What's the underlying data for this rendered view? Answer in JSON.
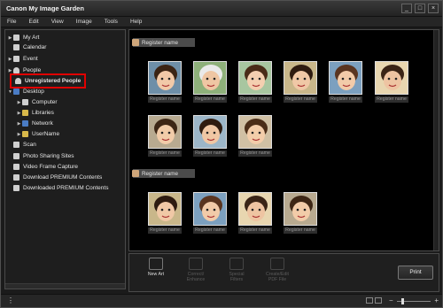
{
  "window": {
    "title": "Canon My Image Garden",
    "controls": [
      "_",
      "□",
      "×"
    ]
  },
  "menu": [
    "File",
    "Edit",
    "View",
    "Image",
    "Tools",
    "Help"
  ],
  "sidebar": {
    "items": [
      {
        "label": "My Art",
        "icon": "my-art-icon"
      },
      {
        "label": "Calendar",
        "icon": "calendar-icon"
      },
      {
        "label": "Event",
        "icon": "event-icon"
      },
      {
        "label": "People",
        "icon": "people-icon"
      },
      {
        "label": "Unregistered People",
        "icon": "unregistered-person-icon",
        "selected": true
      },
      {
        "label": "Desktop",
        "icon": "desktop-icon"
      },
      {
        "label": "Computer",
        "icon": "computer-icon"
      },
      {
        "label": "Libraries",
        "icon": "libraries-icon"
      },
      {
        "label": "Network",
        "icon": "network-icon"
      },
      {
        "label": "UserName",
        "icon": "user-folder-icon"
      },
      {
        "label": "Scan",
        "icon": "scan-icon"
      },
      {
        "label": "Photo Sharing Sites",
        "icon": "photo-sharing-icon"
      },
      {
        "label": "Video Frame Capture",
        "icon": "video-frame-icon"
      },
      {
        "label": "Download PREMIUM Contents",
        "icon": "download-icon"
      },
      {
        "label": "Downloaded PREMIUM Contents",
        "icon": "downloaded-icon"
      }
    ]
  },
  "groups": [
    {
      "title": "Register name",
      "photos": [
        "Register name",
        "Register name",
        "Register name",
        "Register name",
        "Register name",
        "Register name",
        "Register name",
        "Register name",
        "Register name"
      ]
    },
    {
      "title": "Register name",
      "photos": [
        "Register name",
        "Register name",
        "Register name",
        "Register name"
      ]
    }
  ],
  "toolbar": {
    "new_art": "New Art",
    "correct_enhance": "Correct/\nEnhance",
    "special_filters": "Special\nFilters",
    "create_edit_pdf": "Create/Edit\nPDF File",
    "print": "Print"
  },
  "status": {
    "menu_glyph": "⋮",
    "zoom_minus": "−",
    "zoom_plus": "+",
    "zoom_level": 0.15
  },
  "colors": {
    "highlight": "#e00000",
    "background": "#1b1b1b",
    "grid_bg": "#000000"
  }
}
